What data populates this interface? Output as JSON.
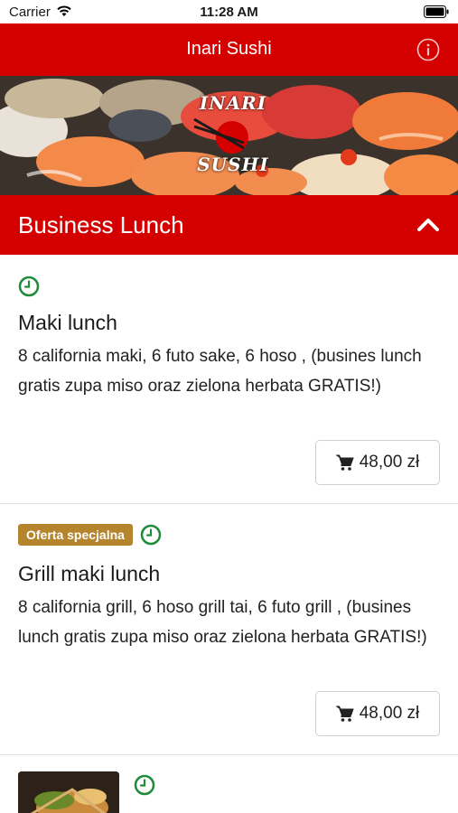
{
  "status_bar": {
    "carrier": "Carrier",
    "time": "11:28 AM"
  },
  "nav": {
    "title": "Inari Sushi"
  },
  "banner": {
    "logo_top": "INARI",
    "logo_bottom": "SUSHI"
  },
  "section": {
    "title": "Business Lunch"
  },
  "items": [
    {
      "name": "Maki lunch",
      "description": "8 california maki, 6 futo sake, 6 hoso , (busines lunch gratis zupa miso oraz zielona herbata GRATIS!)",
      "price": "48,00 zł"
    },
    {
      "badge": "Oferta specjalna",
      "name": "Grill maki lunch",
      "description": "8 california grill, 6 hoso grill tai, 6 futo grill , (busines lunch gratis zupa miso oraz zielona herbata GRATIS!)",
      "price": "48,00 zł"
    }
  ],
  "colors": {
    "brand_red": "#d40000",
    "badge_gold": "#b5852e",
    "clock_green": "#1e8a3a"
  }
}
